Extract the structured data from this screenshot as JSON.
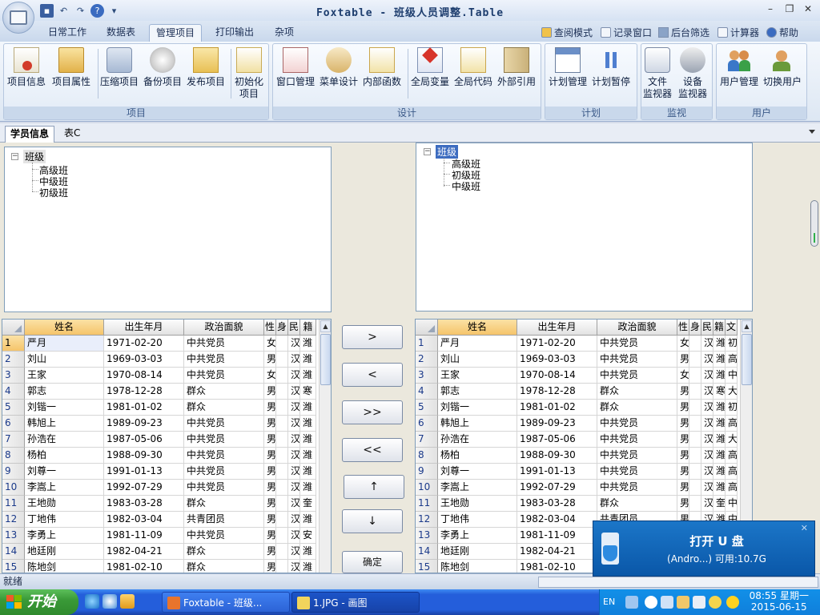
{
  "titlebar": {
    "title": "Foxtable - 班级人员调整.Table",
    "minimize": "–",
    "maximize": "❐",
    "close": "✕"
  },
  "ribbon_tabs": [
    "日常工作",
    "数据表",
    "管理项目",
    "打印输出",
    "杂项"
  ],
  "ribbon_tools": [
    "查阅模式",
    "记录窗口",
    "后台筛选",
    "计算器",
    "帮助"
  ],
  "groups": {
    "project": {
      "label": "项目",
      "buttons": [
        "项目信息",
        "项目属性",
        "压缩项目",
        "备份项目",
        "发布项目",
        "初始化",
        "项目"
      ]
    },
    "design": {
      "label": "设计",
      "buttons": [
        "窗口管理",
        "菜单设计",
        "内部函数",
        "全局变量",
        "全局代码",
        "外部引用"
      ]
    },
    "plan": {
      "label": "计划",
      "buttons": [
        "计划管理",
        "计划暂停"
      ]
    },
    "monitor": {
      "label": "监视",
      "buttons": [
        "文件",
        "监视器",
        "设备",
        "监视器"
      ]
    },
    "user": {
      "label": "用户",
      "buttons": [
        "用户管理",
        "切换用户"
      ]
    }
  },
  "doc_tabs": [
    "学员信息",
    "表C"
  ],
  "left_tree": {
    "root": "班级",
    "children": [
      "高级班",
      "中级班",
      "初级班"
    ]
  },
  "right_tree": {
    "root": "班级",
    "children": [
      "高级班",
      "初级班",
      "中级班"
    ]
  },
  "columns": [
    "姓名",
    "出生年月",
    "政治面貌",
    "性",
    "身",
    "民",
    "籍",
    "文"
  ],
  "left_rows": [
    [
      "1",
      "严月",
      "1971-02-20",
      "中共党员",
      "女",
      "",
      "汉",
      "潍"
    ],
    [
      "2",
      "刘山",
      "1969-03-03",
      "中共党员",
      "男",
      "",
      "汉",
      "潍"
    ],
    [
      "3",
      "王家",
      "1970-08-14",
      "中共党员",
      "女",
      "",
      "汉",
      "潍"
    ],
    [
      "4",
      "郭志",
      "1978-12-28",
      "群众",
      "男",
      "",
      "汉",
      "寒"
    ],
    [
      "5",
      "刘锴一",
      "1981-01-02",
      "群众",
      "男",
      "",
      "汉",
      "潍"
    ],
    [
      "6",
      "韩旭上",
      "1989-09-23",
      "中共党员",
      "男",
      "",
      "汉",
      "潍"
    ],
    [
      "7",
      "孙浩在",
      "1987-05-06",
      "中共党员",
      "男",
      "",
      "汉",
      "潍"
    ],
    [
      "8",
      "杨柏",
      "1988-09-30",
      "中共党员",
      "男",
      "",
      "汉",
      "潍"
    ],
    [
      "9",
      "刘尊一",
      "1991-01-13",
      "中共党员",
      "男",
      "",
      "汉",
      "潍"
    ],
    [
      "10",
      "李嵩上",
      "1992-07-29",
      "中共党员",
      "男",
      "",
      "汉",
      "潍"
    ],
    [
      "11",
      "王地勋",
      "1983-03-28",
      "群众",
      "男",
      "",
      "汉",
      "奎"
    ],
    [
      "12",
      "丁地伟",
      "1982-03-04",
      "共青团员",
      "男",
      "",
      "汉",
      "潍"
    ],
    [
      "13",
      "李勇上",
      "1981-11-09",
      "中共党员",
      "男",
      "",
      "汉",
      "安"
    ],
    [
      "14",
      "地廷刚",
      "1982-04-21",
      "群众",
      "男",
      "",
      "汉",
      "潍"
    ],
    [
      "15",
      "陈地剑",
      "1981-02-10",
      "群众",
      "男",
      "",
      "汉",
      "潍"
    ]
  ],
  "right_rows": [
    [
      "1",
      "严月",
      "1971-02-20",
      "中共党员",
      "女",
      "",
      "汉",
      "潍",
      "初"
    ],
    [
      "2",
      "刘山",
      "1969-03-03",
      "中共党员",
      "男",
      "",
      "汉",
      "潍",
      "高"
    ],
    [
      "3",
      "王家",
      "1970-08-14",
      "中共党员",
      "女",
      "",
      "汉",
      "潍",
      "中"
    ],
    [
      "4",
      "郭志",
      "1978-12-28",
      "群众",
      "男",
      "",
      "汉",
      "寒",
      "大"
    ],
    [
      "5",
      "刘锴一",
      "1981-01-02",
      "群众",
      "男",
      "",
      "汉",
      "潍",
      "初"
    ],
    [
      "6",
      "韩旭上",
      "1989-09-23",
      "中共党员",
      "男",
      "",
      "汉",
      "潍",
      "高"
    ],
    [
      "7",
      "孙浩在",
      "1987-05-06",
      "中共党员",
      "男",
      "",
      "汉",
      "潍",
      "大"
    ],
    [
      "8",
      "杨柏",
      "1988-09-30",
      "中共党员",
      "男",
      "",
      "汉",
      "潍",
      "高"
    ],
    [
      "9",
      "刘尊一",
      "1991-01-13",
      "中共党员",
      "男",
      "",
      "汉",
      "潍",
      "高"
    ],
    [
      "10",
      "李嵩上",
      "1992-07-29",
      "中共党员",
      "男",
      "",
      "汉",
      "潍",
      "高"
    ],
    [
      "11",
      "王地勋",
      "1983-03-28",
      "群众",
      "男",
      "",
      "汉",
      "奎",
      "中"
    ],
    [
      "12",
      "丁地伟",
      "1982-03-04",
      "共青团员",
      "男",
      "",
      "汉",
      "潍",
      "中"
    ],
    [
      "13",
      "李勇上",
      "1981-11-09",
      "",
      "",
      "",
      "",
      "",
      ""
    ],
    [
      "14",
      "地廷刚",
      "1982-04-21",
      "",
      "",
      "",
      "",
      "",
      ""
    ],
    [
      "15",
      "陈地剑",
      "1981-02-10",
      "",
      "",
      "",
      "",
      "",
      ""
    ]
  ],
  "action_buttons": [
    ">",
    "<",
    ">>",
    "<<",
    "↑",
    "↓",
    "确定"
  ],
  "status": "就绪",
  "toast": {
    "title": "打开 U 盘",
    "subtitle": "(Andro...)  可用:10.7G",
    "close": "✕"
  },
  "taskbar": {
    "start": "开始",
    "tasks": [
      "Foxtable - 班级...",
      "1.JPG - 画图"
    ],
    "lang": "EN",
    "time": "08:55 星期一",
    "date": "2015-06-15"
  },
  "colors": {
    "accent": "#245edb",
    "header_sel": "#f5c46a",
    "toast_bg": "#0a57a8"
  }
}
